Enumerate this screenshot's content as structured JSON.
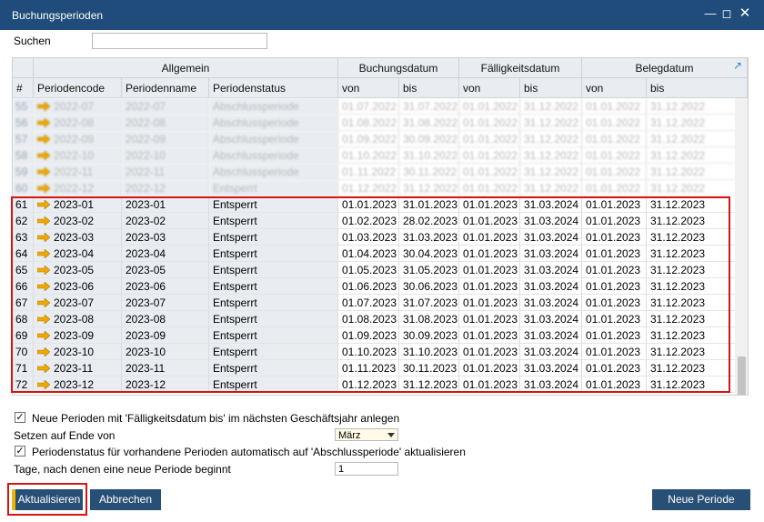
{
  "window": {
    "title": "Buchungsperioden",
    "controls": [
      "minimize",
      "maximize",
      "close"
    ]
  },
  "search": {
    "label": "Suchen",
    "value": ""
  },
  "grid": {
    "group_headers": {
      "general": "Allgemein",
      "posting_date": "Buchungsdatum",
      "due_date": "Fälligkeitsdatum",
      "document_date": "Belegdatum"
    },
    "columns": {
      "num": "#",
      "code": "Periodencode",
      "name": "Periodenname",
      "status": "Periodenstatus",
      "posting_from": "von",
      "posting_to": "bis",
      "due_from": "von",
      "due_to": "bis",
      "doc_from": "von",
      "doc_to": "bis"
    },
    "blurred_rows": [
      {
        "num": "55",
        "code": "2022-07",
        "name": "2022-07",
        "status": "Abschlussperiode",
        "p_from": "01.07.2022",
        "p_to": "31.07.2022",
        "d_from": "01.01.2022",
        "d_to": "31.12.2022",
        "b_from": "01.01.2022",
        "b_to": "31.12.2022"
      },
      {
        "num": "56",
        "code": "2022-08",
        "name": "2022-08",
        "status": "Abschlussperiode",
        "p_from": "01.08.2022",
        "p_to": "31.08.2022",
        "d_from": "01.01.2022",
        "d_to": "31.12.2022",
        "b_from": "01.01.2022",
        "b_to": "31.12.2022"
      },
      {
        "num": "57",
        "code": "2022-09",
        "name": "2022-09",
        "status": "Abschlussperiode",
        "p_from": "01.09.2022",
        "p_to": "30.09.2022",
        "d_from": "01.01.2022",
        "d_to": "31.12.2022",
        "b_from": "01.01.2022",
        "b_to": "31.12.2022"
      },
      {
        "num": "58",
        "code": "2022-10",
        "name": "2022-10",
        "status": "Abschlussperiode",
        "p_from": "01.10.2022",
        "p_to": "31.10.2022",
        "d_from": "01.01.2022",
        "d_to": "31.12.2022",
        "b_from": "01.01.2022",
        "b_to": "31.12.2022"
      },
      {
        "num": "59",
        "code": "2022-11",
        "name": "2022-11",
        "status": "Abschlussperiode",
        "p_from": "01.11.2022",
        "p_to": "30.11.2022",
        "d_from": "01.01.2022",
        "d_to": "31.12.2022",
        "b_from": "01.01.2022",
        "b_to": "31.12.2022"
      },
      {
        "num": "60",
        "code": "2022-12",
        "name": "2022-12",
        "status": "Entsperrt",
        "p_from": "01.12.2022",
        "p_to": "31.12.2022",
        "d_from": "01.01.2022",
        "d_to": "31.12.2022",
        "b_from": "01.01.2022",
        "b_to": "31.12.2022"
      }
    ],
    "rows": [
      {
        "num": "61",
        "code": "2023-01",
        "name": "2023-01",
        "status": "Entsperrt",
        "p_from": "01.01.2023",
        "p_to": "31.01.2023",
        "d_from": "01.01.2023",
        "d_to": "31.03.2024",
        "b_from": "01.01.2023",
        "b_to": "31.12.2023"
      },
      {
        "num": "62",
        "code": "2023-02",
        "name": "2023-02",
        "status": "Entsperrt",
        "p_from": "01.02.2023",
        "p_to": "28.02.2023",
        "d_from": "01.01.2023",
        "d_to": "31.03.2024",
        "b_from": "01.01.2023",
        "b_to": "31.12.2023"
      },
      {
        "num": "63",
        "code": "2023-03",
        "name": "2023-03",
        "status": "Entsperrt",
        "p_from": "01.03.2023",
        "p_to": "31.03.2023",
        "d_from": "01.01.2023",
        "d_to": "31.03.2024",
        "b_from": "01.01.2023",
        "b_to": "31.12.2023"
      },
      {
        "num": "64",
        "code": "2023-04",
        "name": "2023-04",
        "status": "Entsperrt",
        "p_from": "01.04.2023",
        "p_to": "30.04.2023",
        "d_from": "01.01.2023",
        "d_to": "31.03.2024",
        "b_from": "01.01.2023",
        "b_to": "31.12.2023"
      },
      {
        "num": "65",
        "code": "2023-05",
        "name": "2023-05",
        "status": "Entsperrt",
        "p_from": "01.05.2023",
        "p_to": "31.05.2023",
        "d_from": "01.01.2023",
        "d_to": "31.03.2024",
        "b_from": "01.01.2023",
        "b_to": "31.12.2023"
      },
      {
        "num": "66",
        "code": "2023-06",
        "name": "2023-06",
        "status": "Entsperrt",
        "p_from": "01.06.2023",
        "p_to": "30.06.2023",
        "d_from": "01.01.2023",
        "d_to": "31.03.2024",
        "b_from": "01.01.2023",
        "b_to": "31.12.2023"
      },
      {
        "num": "67",
        "code": "2023-07",
        "name": "2023-07",
        "status": "Entsperrt",
        "p_from": "01.07.2023",
        "p_to": "31.07.2023",
        "d_from": "01.01.2023",
        "d_to": "31.03.2024",
        "b_from": "01.01.2023",
        "b_to": "31.12.2023"
      },
      {
        "num": "68",
        "code": "2023-08",
        "name": "2023-08",
        "status": "Entsperrt",
        "p_from": "01.08.2023",
        "p_to": "31.08.2023",
        "d_from": "01.01.2023",
        "d_to": "31.03.2024",
        "b_from": "01.01.2023",
        "b_to": "31.12.2023"
      },
      {
        "num": "69",
        "code": "2023-09",
        "name": "2023-09",
        "status": "Entsperrt",
        "p_from": "01.09.2023",
        "p_to": "30.09.2023",
        "d_from": "01.01.2023",
        "d_to": "31.03.2024",
        "b_from": "01.01.2023",
        "b_to": "31.12.2023"
      },
      {
        "num": "70",
        "code": "2023-10",
        "name": "2023-10",
        "status": "Entsperrt",
        "p_from": "01.10.2023",
        "p_to": "31.10.2023",
        "d_from": "01.01.2023",
        "d_to": "31.03.2024",
        "b_from": "01.01.2023",
        "b_to": "31.12.2023"
      },
      {
        "num": "71",
        "code": "2023-11",
        "name": "2023-11",
        "status": "Entsperrt",
        "p_from": "01.11.2023",
        "p_to": "30.11.2023",
        "d_from": "01.01.2023",
        "d_to": "31.03.2024",
        "b_from": "01.01.2023",
        "b_to": "31.12.2023"
      },
      {
        "num": "72",
        "code": "2023-12",
        "name": "2023-12",
        "status": "Entsperrt",
        "p_from": "01.12.2023",
        "p_to": "31.12.2023",
        "d_from": "01.01.2023",
        "d_to": "31.03.2024",
        "b_from": "01.01.2023",
        "b_to": "31.12.2023"
      }
    ],
    "icons": {
      "row_link": "orange-arrow-icon",
      "expand": "expand-arrow-icon"
    }
  },
  "options": {
    "new_periods_label": "Neue Perioden mit 'Fälligkeitsdatum bis' im nächsten Geschäftsjahr anlegen",
    "new_periods_checked": true,
    "set_end_label": "Setzen auf Ende von",
    "set_end_value": "März",
    "update_status_label": "Periodenstatus für vorhandene Perioden automatisch auf 'Abschlussperiode' aktualisieren",
    "update_status_checked": true,
    "days_label": "Tage, nach denen eine neue Periode beginnt",
    "days_value": "1"
  },
  "buttons": {
    "update": "Aktualisieren",
    "cancel": "Abbrechen",
    "new_period": "Neue Periode"
  },
  "colors": {
    "titlebar": "#1f4c7a",
    "button": "#284f76",
    "highlight": "#d51414",
    "arrow": "#f0a800"
  }
}
